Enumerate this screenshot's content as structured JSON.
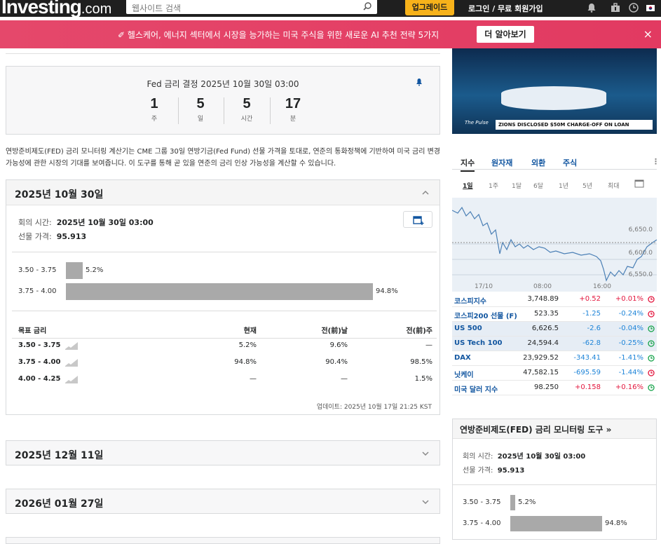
{
  "header": {
    "logo_main": "Investing",
    "logo_suffix": ".com",
    "search_placeholder": "웹사이트 검색",
    "upgrade": "업그레이드",
    "login": "로그인 / 무료 회원가입"
  },
  "promo": {
    "text": "헬스케어, 에너지 섹터에서 시장을 능가하는 미국 주식을 위한 새로운 AI 추천 전략 5가지",
    "button": "더 알아보기",
    "close": "×"
  },
  "fed": {
    "title": "Fed 금리 결정 2025년 10월 30일 03:00",
    "countdown": [
      {
        "num": "1",
        "label": "주"
      },
      {
        "num": "5",
        "label": "일"
      },
      {
        "num": "5",
        "label": "시간"
      },
      {
        "num": "17",
        "label": "분"
      }
    ]
  },
  "description": "연방준비제도(FED) 금리 모니터링 계산기는 CME 그룹 30일 연방기금(Fed Fund) 선물 가격을 토대로, 연준의 통화정책에 기반하여 미국 금리 변경 가능성에 관한 시장의 기대를 보여줍니다. 이 도구를 통해 곧 있을 연준의 금리 인상 가능성을 계산할 수 있습니다.",
  "meeting": {
    "title": "2025년 10월 30일",
    "time_label": "회의 시간:",
    "time": "2025년 10월 30일 03:00",
    "price_label": "선물 가격:",
    "price": "95.913",
    "bars": [
      {
        "range": "3.50 - 3.75",
        "pct": 5.2,
        "label": "5.2%"
      },
      {
        "range": "3.75 - 4.00",
        "pct": 94.8,
        "label": "94.8%"
      }
    ],
    "table": {
      "headers": [
        "목표 금리",
        "현재",
        "전(前)날",
        "전(前)주"
      ],
      "rows": [
        [
          "3.50 - 3.75",
          "5.2%",
          "9.6%",
          "—"
        ],
        [
          "3.75 - 4.00",
          "94.8%",
          "90.4%",
          "98.5%"
        ],
        [
          "4.00 - 4.25",
          "—",
          "—",
          "1.5%"
        ]
      ]
    },
    "updated": "업데이트: 2025년 10월 17일 21:25 KST"
  },
  "collapsed": [
    "2025년 12월 11일",
    "2026년 01월 27일"
  ],
  "video": {
    "banner": "ZIONS DISCLOSED $50M CHARGE-OFF ON LOAN",
    "show": "The Pulse"
  },
  "markets": {
    "tabs": [
      "지수",
      "원자재",
      "외환",
      "주식"
    ],
    "periods": [
      "1일",
      "1주",
      "1달",
      "6달",
      "1년",
      "5년",
      "최대"
    ],
    "chart": {
      "y_ticks": [
        "6,650.0",
        "6,600.0",
        "6,550.0"
      ],
      "x_ticks": [
        "17/10",
        "08:00",
        "16:00"
      ]
    },
    "rows": [
      {
        "name": "코스피지수",
        "last": "3,748.89",
        "chg": "+0.52",
        "pct": "+0.01%",
        "dir": "up",
        "clock": "red"
      },
      {
        "name": "코스피200 선물 (F)",
        "last": "523.35",
        "chg": "-1.25",
        "pct": "-0.24%",
        "dir": "down",
        "clock": "red"
      },
      {
        "name": "US 500",
        "last": "6,626.5",
        "chg": "-2.6",
        "pct": "-0.04%",
        "dir": "down",
        "clock": "green"
      },
      {
        "name": "US Tech 100",
        "last": "24,594.4",
        "chg": "-62.8",
        "pct": "-0.25%",
        "dir": "down",
        "clock": "green"
      },
      {
        "name": "DAX",
        "last": "23,929.52",
        "chg": "-343.41",
        "pct": "-1.41%",
        "dir": "down",
        "clock": "green"
      },
      {
        "name": "닛케이",
        "last": "47,582.15",
        "chg": "-695.59",
        "pct": "-1.44%",
        "dir": "down",
        "clock": "red"
      },
      {
        "name": "미국 달러 지수",
        "last": "98.250",
        "chg": "+0.158",
        "pct": "+0.16%",
        "dir": "up",
        "clock": "green"
      }
    ]
  },
  "side_tool": {
    "title": "연방준비제도(FED) 금리 모니터링 도구 »",
    "time_label": "회의 시간:",
    "time": "2025년 10월 30일 03:00",
    "price_label": "선물 가격:",
    "price": "95.913",
    "bars": [
      {
        "range": "3.50 - 3.75",
        "pct": 5.2,
        "label": "5.2%"
      },
      {
        "range": "3.75 - 4.00",
        "pct": 94.8,
        "label": "94.8%"
      }
    ]
  }
}
